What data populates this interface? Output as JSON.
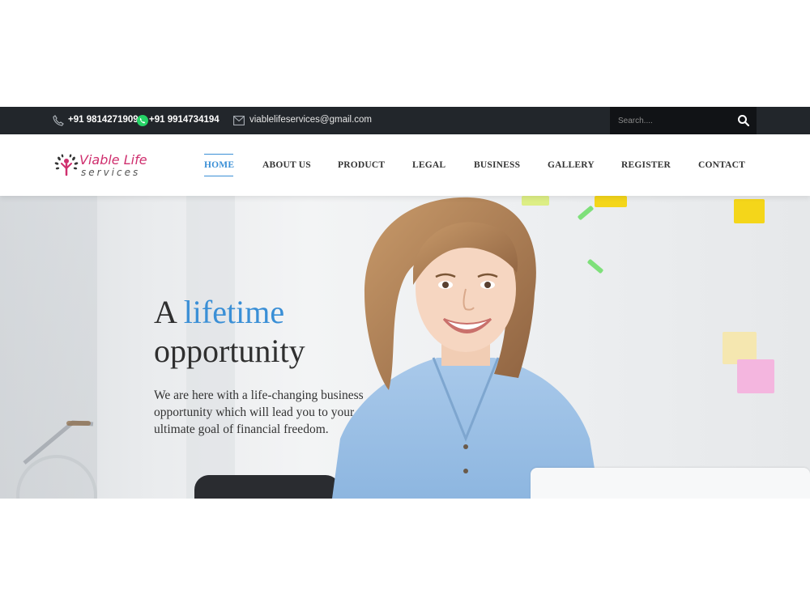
{
  "topbar": {
    "phone_primary": "+91 9814271909",
    "phone_whatsapp": "+91 9914734194",
    "email": "viablelifeservices@gmail.com",
    "search_placeholder": "Search....",
    "icons": [
      "phone-icon",
      "whatsapp-icon",
      "mail-icon",
      "search-icon"
    ]
  },
  "brand": {
    "name_line1": "Viable Life",
    "name_line2": "services",
    "color": "#cf2f6e"
  },
  "nav": {
    "items": [
      {
        "label": "HOME",
        "active": true
      },
      {
        "label": "ABOUT US",
        "active": false
      },
      {
        "label": "PRODUCT",
        "active": false
      },
      {
        "label": "LEGAL",
        "active": false
      },
      {
        "label": "BUSINESS",
        "active": false
      },
      {
        "label": "GALLERY",
        "active": false
      },
      {
        "label": "REGISTER",
        "active": false
      },
      {
        "label": "CONTACT",
        "active": false
      }
    ],
    "active_color": "#3a8fd6"
  },
  "hero": {
    "headline_start": "A",
    "headline_accent": "lifetime",
    "headline_end": "opportunity",
    "body": "We are here with a life-changing business opportunity which will lead you to your ultimate goal of financial freedom."
  },
  "colors": {
    "topbar_bg": "#22262b",
    "accent": "#3a8fd6",
    "text": "#2f2f2f"
  }
}
